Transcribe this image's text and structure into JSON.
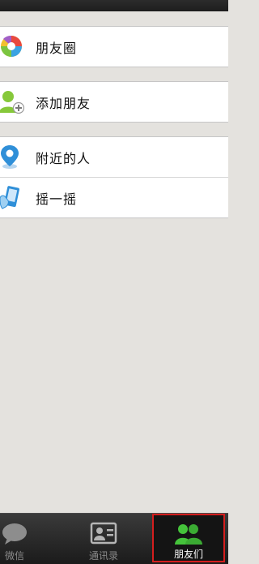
{
  "menu": {
    "moments": {
      "label": "朋友圈",
      "icon": "moments-icon"
    },
    "add_friends": {
      "label": "添加朋友",
      "icon": "add-friend-icon"
    },
    "people_nearby": {
      "label": "附近的人",
      "icon": "location-pin-icon"
    },
    "shake": {
      "label": "摇一摇",
      "icon": "shake-phone-icon"
    }
  },
  "tabbar": {
    "tabs": [
      {
        "label": "微信",
        "icon": "chat-bubble-icon"
      },
      {
        "label": "通讯录",
        "icon": "contacts-card-icon"
      },
      {
        "label": "朋友们",
        "icon": "friends-icon",
        "active": true
      }
    ]
  },
  "colors": {
    "background": "#e4e2de",
    "active_highlight": "#d41e1e",
    "friends_icon_green": "#45c33b",
    "nearby_pin_blue": "#2f8fd8"
  }
}
